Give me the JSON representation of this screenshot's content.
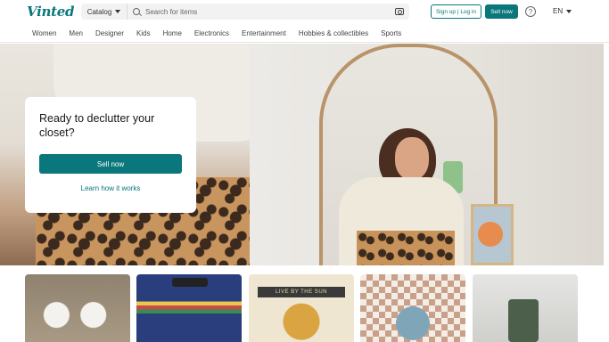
{
  "header": {
    "logo": "Vinted",
    "catalog_label": "Catalog",
    "search_placeholder": "Search for items",
    "signup_label": "Sign up | Log in",
    "sell_label": "Sell now",
    "help_symbol": "?",
    "language": "EN"
  },
  "nav": {
    "items": [
      {
        "label": "Women"
      },
      {
        "label": "Men"
      },
      {
        "label": "Designer"
      },
      {
        "label": "Kids"
      },
      {
        "label": "Home"
      },
      {
        "label": "Electronics"
      },
      {
        "label": "Entertainment"
      },
      {
        "label": "Hobbies & collectibles"
      },
      {
        "label": "Sports"
      }
    ]
  },
  "hero": {
    "title": "Ready to declutter your closet?",
    "button_label": "Sell now",
    "link_label": "Learn how it works"
  },
  "products": {
    "items": [
      {
        "name": "white-shoes"
      },
      {
        "name": "striped-skirt"
      },
      {
        "name": "live-by-the-sun-print",
        "banner": "LIVE BY THE SUN"
      },
      {
        "name": "checkered-smiley-sweater"
      },
      {
        "name": "tumbler-cup"
      }
    ]
  },
  "colors": {
    "brand": "#09777b",
    "text": "#171717"
  }
}
